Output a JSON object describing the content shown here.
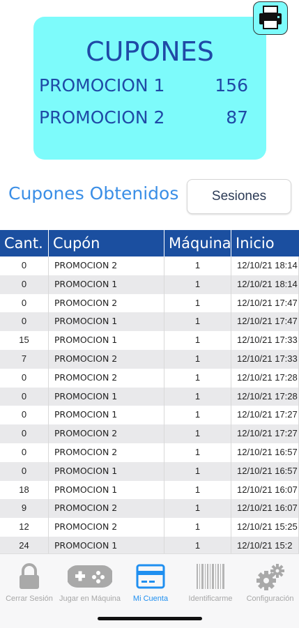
{
  "summary": {
    "title": "CUPONES",
    "promotions": [
      {
        "name": "PROMOCION 1",
        "value": "156"
      },
      {
        "name": "PROMOCION 2",
        "value": "87"
      }
    ],
    "print_icon": "printer-icon"
  },
  "section": {
    "title": "Cupones Obtenidos",
    "sessions_button": "Sesiones"
  },
  "table": {
    "headers": [
      "Cant.",
      "Cupón",
      "Máquina",
      "Inicio"
    ],
    "rows": [
      [
        "0",
        "PROMOCION 2",
        "1",
        "12/10/21 18:14"
      ],
      [
        "0",
        "PROMOCION 1",
        "1",
        "12/10/21 18:14"
      ],
      [
        "0",
        "PROMOCION 2",
        "1",
        "12/10/21 17:47"
      ],
      [
        "0",
        "PROMOCION 1",
        "1",
        "12/10/21 17:47"
      ],
      [
        "15",
        "PROMOCION 1",
        "1",
        "12/10/21 17:33"
      ],
      [
        "7",
        "PROMOCION 2",
        "1",
        "12/10/21 17:33"
      ],
      [
        "0",
        "PROMOCION 2",
        "1",
        "12/10/21 17:28"
      ],
      [
        "0",
        "PROMOCION 1",
        "1",
        "12/10/21 17:28"
      ],
      [
        "0",
        "PROMOCION 1",
        "1",
        "12/10/21 17:27"
      ],
      [
        "0",
        "PROMOCION 2",
        "1",
        "12/10/21 17:27"
      ],
      [
        "0",
        "PROMOCION 2",
        "1",
        "12/10/21 16:57"
      ],
      [
        "0",
        "PROMOCION 1",
        "1",
        "12/10/21 16:57"
      ],
      [
        "18",
        "PROMOCION 1",
        "1",
        "12/10/21 16:07"
      ],
      [
        "9",
        "PROMOCION 2",
        "1",
        "12/10/21 16:07"
      ],
      [
        "12",
        "PROMOCION 2",
        "1",
        "12/10/21 15:25"
      ],
      [
        "24",
        "PROMOCION 1",
        "1",
        "12/10/21 15:2"
      ]
    ]
  },
  "tabbar": {
    "tabs": [
      {
        "label": "Cerrar Sesión",
        "icon": "lock-icon"
      },
      {
        "label": "Jugar en Máquina",
        "icon": "gamepad-icon"
      },
      {
        "label": "Mi Cuenta",
        "icon": "card-icon",
        "active": true
      },
      {
        "label": "Identificarme",
        "icon": "barcode-icon"
      },
      {
        "label": "Configuración",
        "icon": "gears-icon"
      }
    ]
  },
  "colors": {
    "summary_bg": "#7dfbfb",
    "summary_text": "#1f4aa6",
    "header_bg": "#1b4fa0",
    "accent": "#1f8ff0",
    "section_title": "#3a8ee6"
  }
}
